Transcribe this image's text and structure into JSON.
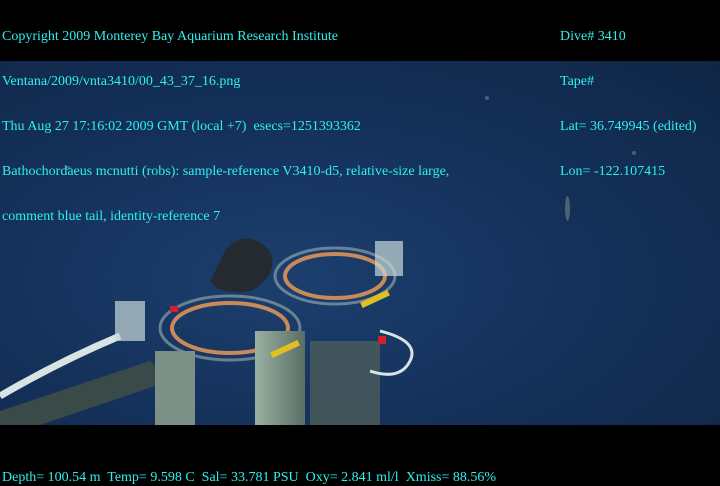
{
  "header_left": [
    "Copyright 2009 Monterey Bay Aquarium Research Institute",
    "Ventana/2009/vnta3410/00_43_37_16.png",
    "Thu Aug 27 17:16:02 2009 GMT (local +7)  esecs=1251393362",
    "Bathochordaeus mcnutti (robs): sample-reference V3410-d5, relative-size large,",
    "comment blue tail, identity-reference 7"
  ],
  "header_right": [
    "Dive# 3410",
    "Tape#",
    "Lat= 36.749945 (edited)",
    "Lon= -122.107415"
  ],
  "footer": "Depth= 100.54 m  Temp= 9.598 C  Sal= 33.781 PSU  Oxy= 2.841 ml/l  Xmiss= 88.56%",
  "colors": {
    "overlay_text": "#2ff0ee",
    "water": "#15325c"
  }
}
